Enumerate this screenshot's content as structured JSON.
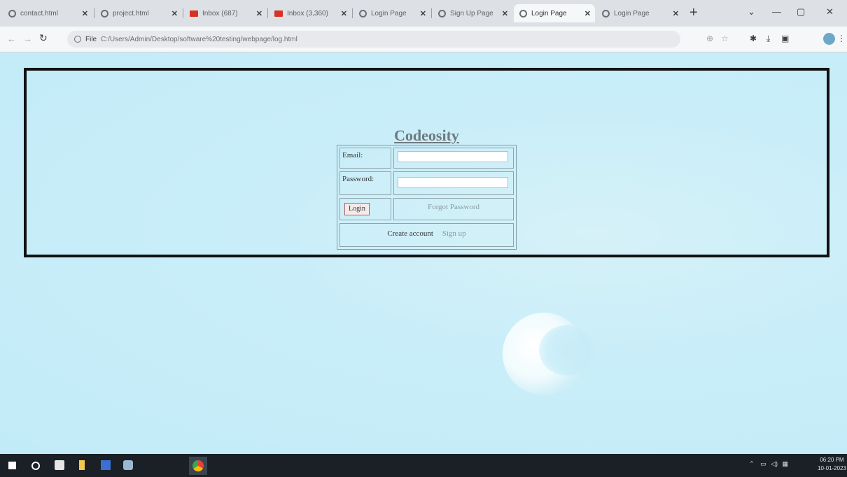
{
  "browser": {
    "tabs": [
      {
        "label": "contact.html",
        "icon": "globe-icon"
      },
      {
        "label": "project.html",
        "icon": "globe-icon"
      },
      {
        "label": "Inbox (687)",
        "icon": "gmail-icon"
      },
      {
        "label": "Inbox (3,360)",
        "icon": "gmail-icon"
      },
      {
        "label": "Login Page",
        "icon": "globe-icon"
      },
      {
        "label": "Sign Up Page",
        "icon": "globe-icon"
      },
      {
        "label": "Login Page",
        "icon": "globe-icon",
        "active": true
      },
      {
        "label": "Login Page",
        "icon": "globe-icon"
      }
    ],
    "new_tab": "+",
    "address": {
      "scheme_label": "File",
      "url": "C:/Users/Admin/Desktop/software%20testing/webpage/log.html"
    }
  },
  "page": {
    "brand": "Codeosity",
    "email_label": "Email:",
    "password_label": "Password:",
    "login_button": "Login",
    "forgot_link": "Forgot Password",
    "create_text": "Create account",
    "signup_link": "Sign up"
  },
  "taskbar": {
    "clock_time": "06:20 PM",
    "clock_date": "10-01-2023"
  },
  "colors": {
    "page_background": "#c6ecf8",
    "frame_border": "#111111",
    "brand_text": "#6e7a7e",
    "taskbar": "#1a2026"
  }
}
